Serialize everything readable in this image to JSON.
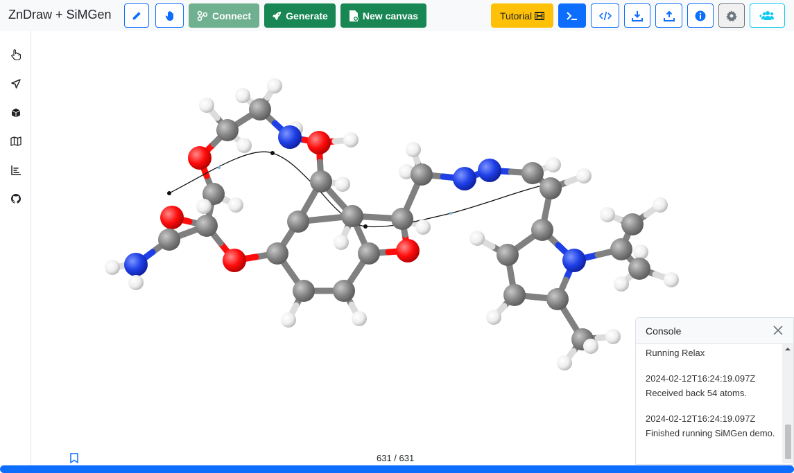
{
  "app": {
    "title": "ZnDraw + SiMGen"
  },
  "toolbar": {
    "connect_label": "Connect",
    "generate_label": "Generate",
    "new_canvas_label": "New canvas",
    "tutorial_label": "Tutorial",
    "icons": [
      "pencil-icon",
      "hand-icon",
      "connect-icon",
      "rocket-icon",
      "new-file-icon",
      "film-icon",
      "terminal-icon",
      "code-icon",
      "download-icon",
      "upload-icon",
      "info-icon",
      "gear-icon",
      "users-icon"
    ]
  },
  "sidebar": {
    "items": [
      {
        "name": "pointer",
        "icon": "hand-pointer-icon"
      },
      {
        "name": "geometry",
        "icon": "location-arrow-icon"
      },
      {
        "name": "modify",
        "icon": "cube-icon"
      },
      {
        "name": "map",
        "icon": "map-icon"
      },
      {
        "name": "analysis",
        "icon": "chart-icon"
      },
      {
        "name": "github",
        "icon": "github-icon"
      }
    ]
  },
  "player": {
    "frame_counter": "631 / 631",
    "progress": 1.0
  },
  "console": {
    "title": "Console",
    "entries": [
      {
        "time": "",
        "message": "Running Relax"
      },
      {
        "time": "2024-02-12T16:24:19.097Z",
        "message": "Received back 54 atoms."
      },
      {
        "time": "2024-02-12T16:24:19.097Z",
        "message": "Finished running SiMGen demo."
      }
    ]
  },
  "colors": {
    "primary": "#0d6efd",
    "success": "#198754",
    "warning": "#ffc107",
    "info": "#0dcaf0",
    "carbon": "#808080",
    "oxygen": "#ff0d0d",
    "nitrogen": "#1e3fe6",
    "hydrogen": "#f2f2f2"
  }
}
